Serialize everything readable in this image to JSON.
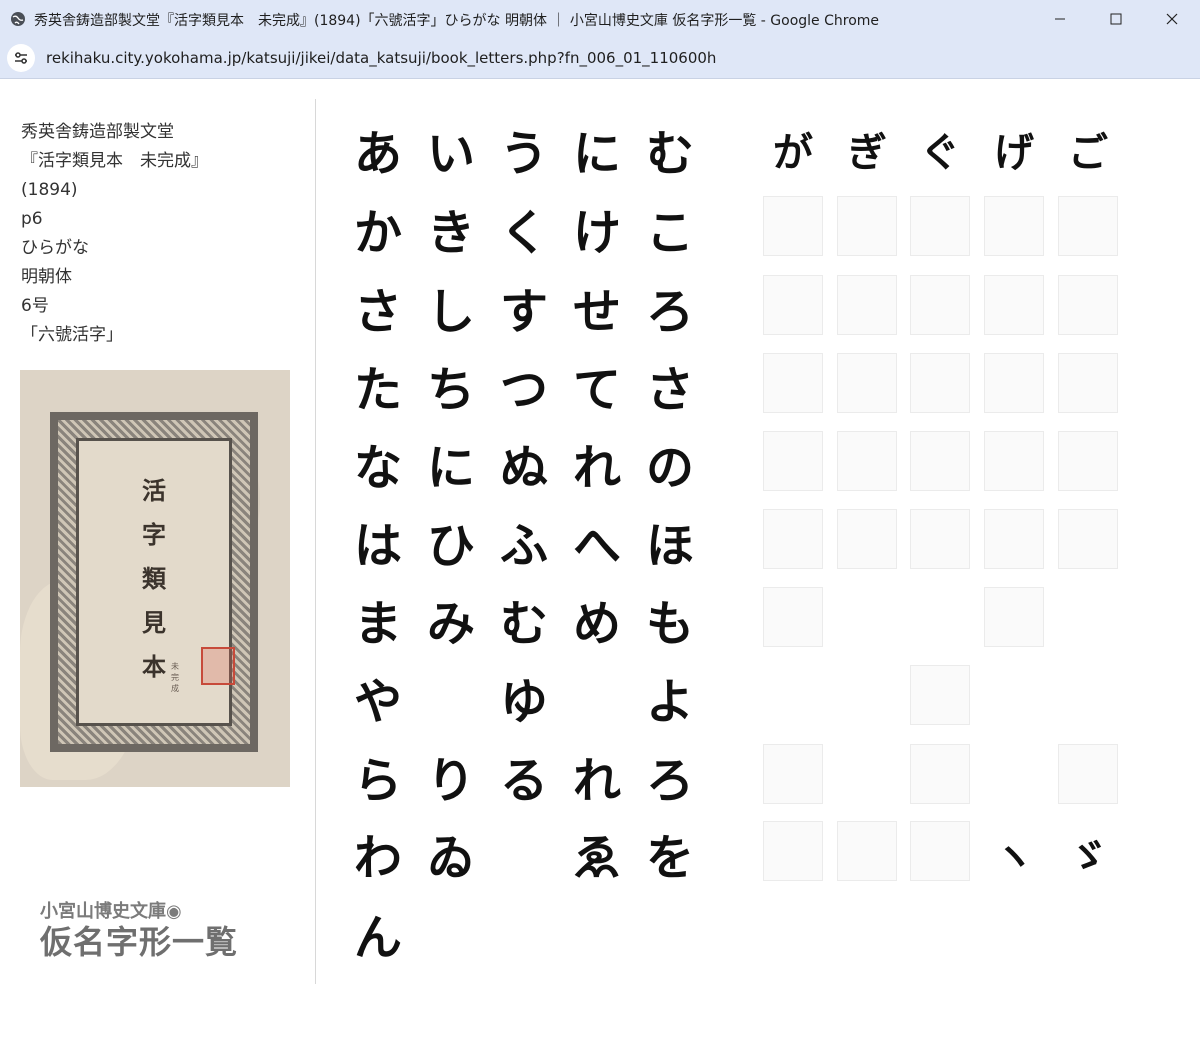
{
  "window": {
    "title": "秀英舎鋳造部製文堂『活字類見本　未完成』(1894)「六號活字」ひらがな 明朝体 ｜ 小宮山博史文庫 仮名字形一覧 - Google Chrome",
    "url": "rekihaku.city.yokohama.jp/katsuji/jikei/data_katsuji/book_letters.php?fn_006_01_110600h"
  },
  "meta": [
    "秀英舎鋳造部製文堂",
    "『活字類見本　未完成』",
    "(1894)",
    "p6",
    "ひらがな",
    "明朝体",
    "6号",
    "「六號活字」"
  ],
  "cover": {
    "title": "活字類見本",
    "subtitle": "未完成"
  },
  "brand": {
    "small": "小宮山博史文庫◉",
    "large": "仮名字形一覧"
  },
  "kana": {
    "col1": [
      "あ",
      "か",
      "さ",
      "た",
      "な",
      "は",
      "ま",
      "や",
      "ら",
      "わ",
      "ん"
    ],
    "col2": [
      "い",
      "き",
      "し",
      "ち",
      "に",
      "ひ",
      "み",
      "",
      "り",
      "ゐ"
    ],
    "col3": [
      "う",
      "く",
      "す",
      "つ",
      "ぬ",
      "ふ",
      "む",
      "ゆ",
      "る",
      ""
    ],
    "col4": [
      "に",
      "け",
      "せ",
      "て",
      "れ",
      "へ",
      "め",
      "",
      "れ",
      "ゑ"
    ],
    "col5": [
      "む",
      "こ",
      "ろ",
      "さ",
      "の",
      "ほ",
      "も",
      "よ",
      "ろ",
      "を"
    ],
    "voiced": [
      "が",
      "ぎ",
      "ぐ",
      "げ",
      "ご"
    ],
    "marks": [
      "ヽ",
      "ゞ"
    ]
  }
}
